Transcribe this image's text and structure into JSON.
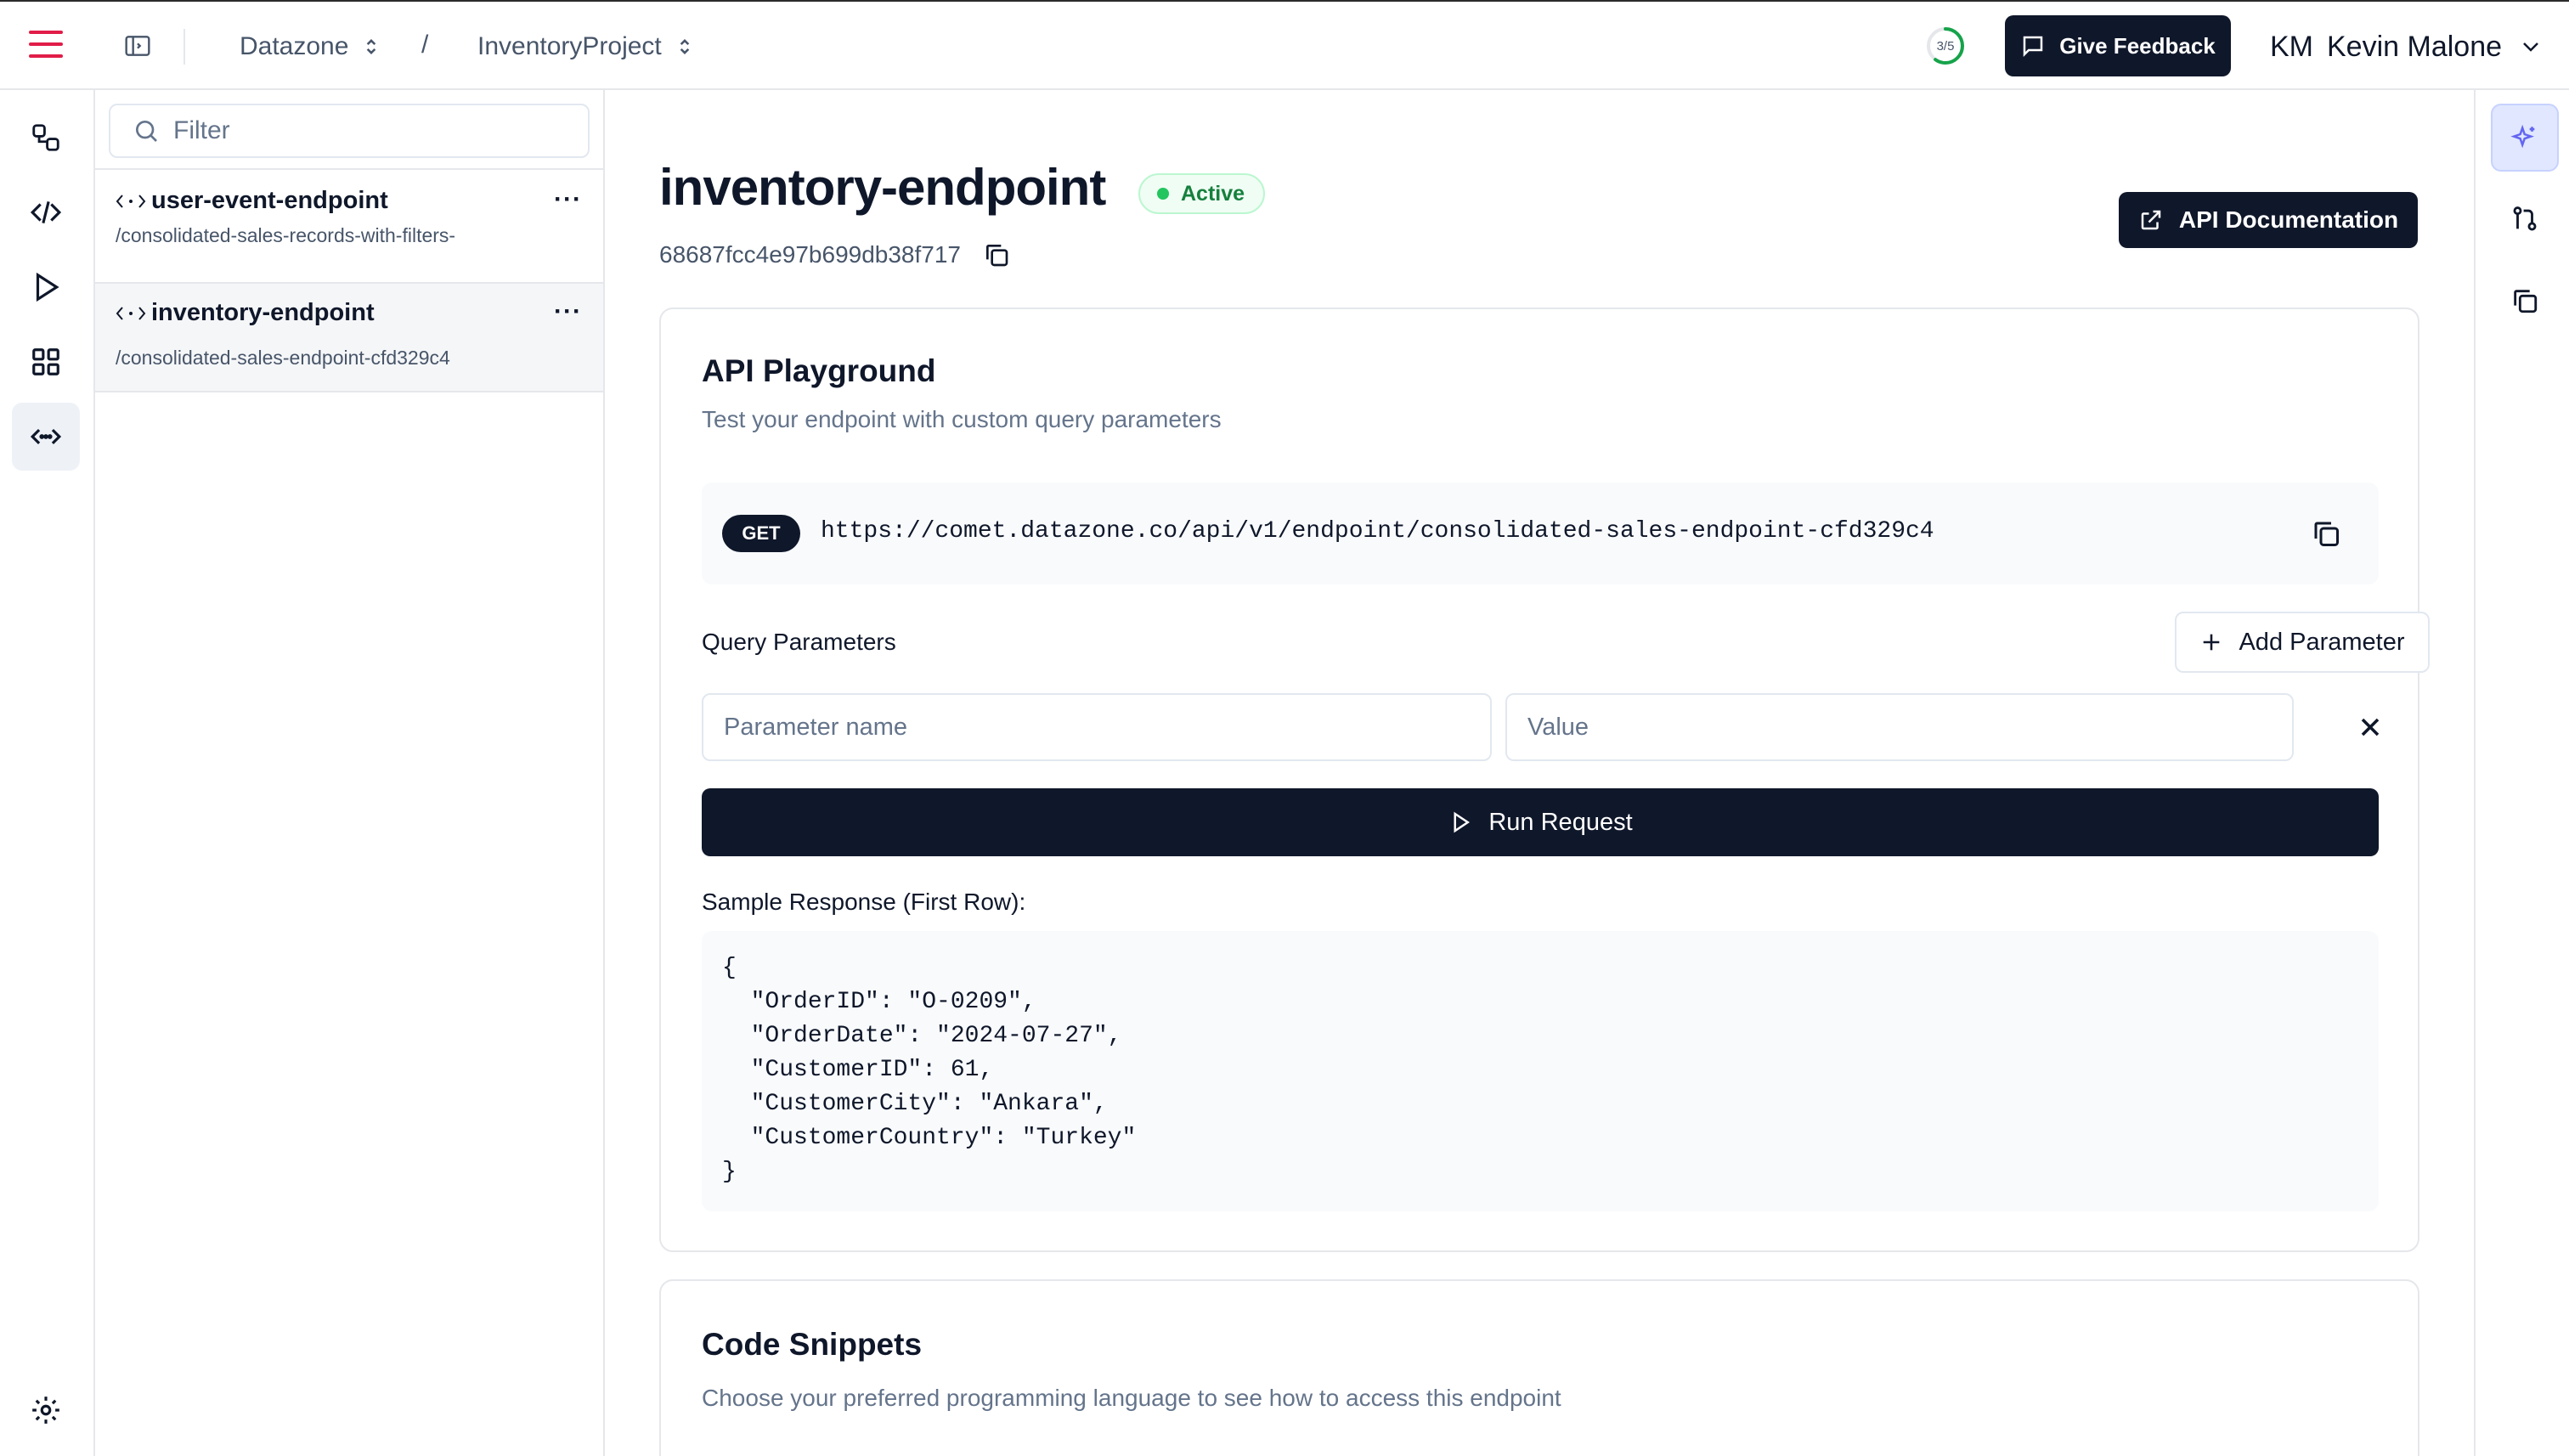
{
  "header": {
    "workspace": "Datazone",
    "separator": "/",
    "project": "InventoryProject",
    "progress_label": "3/5",
    "progress_fraction": 0.6,
    "feedback_label": "Give Feedback",
    "user_initials": "KM",
    "user_name": "Kevin Malone"
  },
  "rail": {
    "items": [
      "transform-icon",
      "code-icon",
      "play-icon",
      "grid-icon",
      "endpoint-icon"
    ],
    "active": "endpoint-icon",
    "bottom": "gear-icon"
  },
  "sidebar": {
    "filter_placeholder": "Filter",
    "endpoints": [
      {
        "name": "user-event-endpoint",
        "path": "/consolidated-sales-records-with-filters-",
        "more": "···"
      },
      {
        "name": "inventory-endpoint",
        "path": "/consolidated-sales-endpoint-cfd329c4",
        "more": "···"
      }
    ],
    "selected_index": 1
  },
  "main": {
    "title": "inventory-endpoint",
    "status": "Active",
    "id": "68687fcc4e97b699db38f717",
    "docs_label": "API Documentation",
    "playground": {
      "title": "API Playground",
      "subtitle": "Test your endpoint with custom query parameters",
      "method": "GET",
      "url": "https://comet.datazone.co/api/v1/endpoint/consolidated-sales-endpoint-cfd329c4",
      "query_params_label": "Query Parameters",
      "add_param_label": "Add Parameter",
      "param_name_placeholder": "Parameter name",
      "param_value_placeholder": "Value",
      "run_label": "Run Request",
      "response_label": "Sample Response (First Row):",
      "response_body": "{\n  \"OrderID\": \"O-0209\",\n  \"OrderDate\": \"2024-07-27\",\n  \"CustomerID\": 61,\n  \"CustomerCity\": \"Ankara\",\n  \"CustomerCountry\": \"Turkey\"\n}"
    },
    "snippets": {
      "title": "Code Snippets",
      "subtitle": "Choose your preferred programming language to see how to access this endpoint"
    }
  },
  "right_rail": {
    "items": [
      "sparkle-icon",
      "git-branch-icon",
      "copy-icon"
    ],
    "active": "sparkle-icon"
  },
  "colors": {
    "primary": "#0f172a",
    "accent": "#e11d48",
    "status_active": "#22c55e",
    "ai_accent": "#6366f1"
  }
}
